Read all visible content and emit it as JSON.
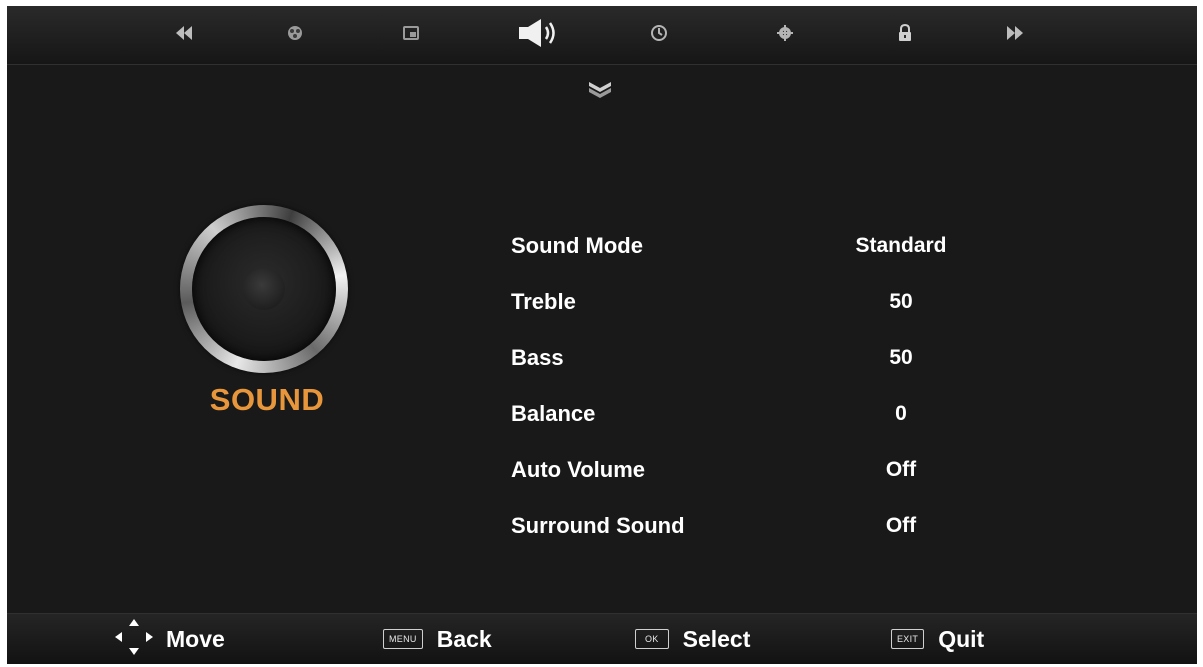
{
  "top_nav": {
    "icons": [
      "double-left-arrow-icon",
      "picture-icon",
      "channel-icon",
      "sound-icon",
      "time-icon",
      "setup-icon",
      "lock-icon",
      "double-right-arrow-icon"
    ],
    "selected": "sound-icon"
  },
  "section": {
    "title": "SOUND",
    "title_color": "#e8963c"
  },
  "menu": {
    "items": [
      {
        "label": "Sound Mode",
        "value": "Standard"
      },
      {
        "label": "Treble",
        "value": "50"
      },
      {
        "label": "Bass",
        "value": "50"
      },
      {
        "label": "Balance",
        "value": "0"
      },
      {
        "label": "Auto Volume",
        "value": "Off"
      },
      {
        "label": "Surround Sound",
        "value": "Off"
      }
    ]
  },
  "footer": {
    "move": {
      "label": "Move"
    },
    "back": {
      "key": "MENU",
      "label": "Back"
    },
    "select": {
      "key": "OK",
      "label": "Select"
    },
    "quit": {
      "key": "EXIT",
      "label": "Quit"
    }
  }
}
